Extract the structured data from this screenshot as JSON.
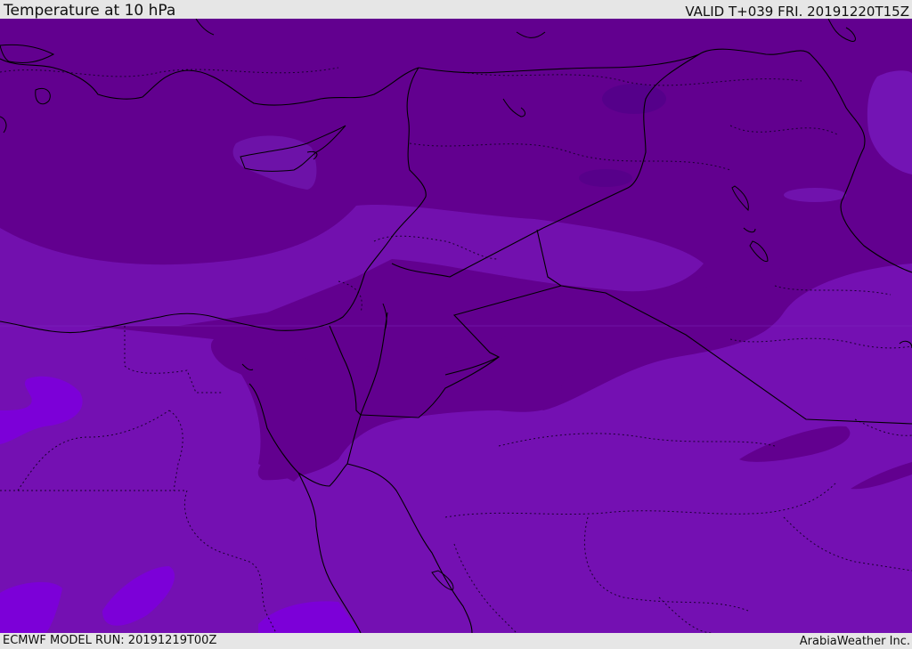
{
  "header": {
    "title": "Temperature at 10 hPa",
    "valid": "VALID T+039 FRI. 20191220T15Z"
  },
  "footer": {
    "model_run": "ECMWF MODEL RUN: 20191219T00Z",
    "credit": "ArabiaWeather Inc."
  },
  "map": {
    "field": "temperature-10hPa",
    "palette": {
      "coldest_band": "#5b008d",
      "cold_band": "#63008f",
      "mid_band": "#7110ae",
      "warm_band": "#6d00b3",
      "warmest_band": "#7c00d8",
      "coastline": "#000000",
      "boundary_dotted": "#1a0030"
    }
  }
}
